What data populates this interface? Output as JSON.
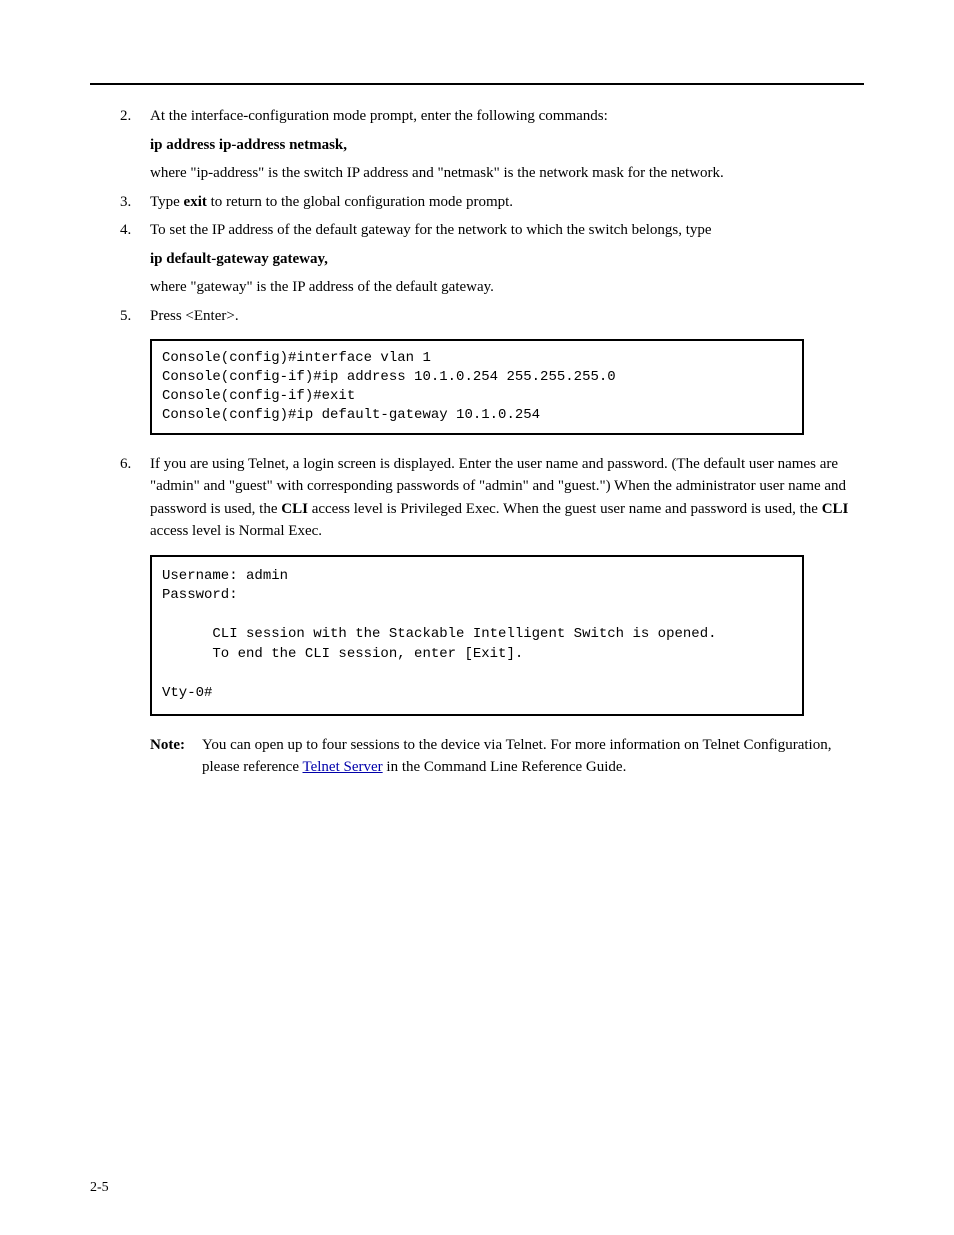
{
  "steps": {
    "s2": {
      "num": "2.",
      "text": "At the interface-configuration mode prompt, enter the following commands:"
    },
    "s2_sub": "ip address ip-address netmask,",
    "s2_where": "where \"ip-address\" is the switch IP address and \"netmask\" is the network mask for the network.",
    "s3": {
      "num": "3.",
      "text": "Type exit to return to the global configuration mode prompt."
    },
    "s4": {
      "num": "4.",
      "text": "To set the IP address of the default gateway for the network to which the switch belongs, type"
    },
    "s4_sub": "ip default-gateway gateway,",
    "s4_where": "where \"gateway\" is the IP address of the default gateway.",
    "s5": {
      "num": "5.",
      "text": "Press <Enter>."
    }
  },
  "cli1": "Console(config)#interface vlan 1\nConsole(config-if)#ip address 10.1.0.254 255.255.255.0\nConsole(config-if)#exit\nConsole(config)#ip default-gateway 10.1.0.254",
  "section_num": "6.",
  "section_text_a": "If you are using Telnet, a login screen is displayed. Enter the user name and password. (The default user names are \"admin\" and \"guest\" with corresponding passwords of \"admin\" and \"guest.\") When the administrator user name and password is used, the ",
  "section_text_b": " access level is Privileged Exec. When the guest user name and password is used, the ",
  "section_text_c": " access level is Normal Exec.",
  "cli_term": "CLI",
  "cli2": "Username: admin\nPassword:\n\n      CLI session with the Stackable Intelligent Switch is opened.\n      To end the CLI session, enter [Exit].\n\nVty-0#",
  "note_label": "Note:",
  "note_text_a": "You can open up to four sessions to the device via Telnet. For more information on Telnet Configuration, please reference ",
  "note_text_b": " in the Command Line Reference Guide.",
  "telnet_link": "Telnet Server",
  "page_num": "2-5"
}
